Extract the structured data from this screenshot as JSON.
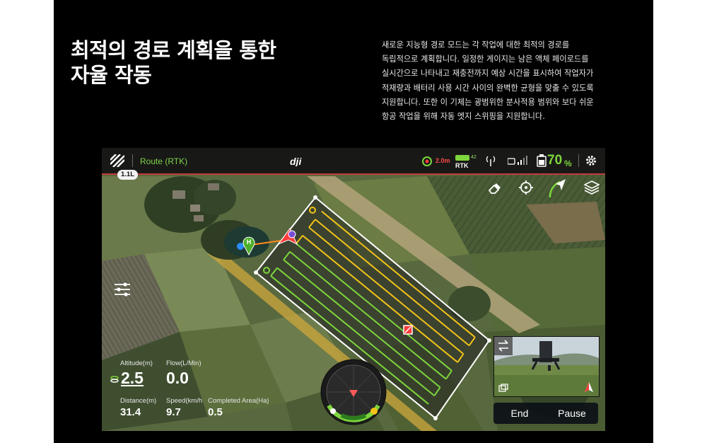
{
  "headline": {
    "line1": "최적의 경로 계획을 통한",
    "line2": "자율 작동"
  },
  "description": [
    "새로운 지능형 경로 모드는 각 작업에 대한 최적의 경로를",
    "독립적으로 계획합니다. 일정한 게이지는 남은 액체 페이로드를",
    "실시간으로 나타내고 재충전까지 예상 시간을 표시하여 작업자가",
    "적재량과 배터리 사용 시간 사이의 완벽한 균형을 맞출 수 있도록",
    "지원합니다. 또한 이 기체는 광범위한 분사적용 범위와 보다 쉬운",
    "항공 작업을 위해 자동 엣지 스위핑을 지원합니다."
  ],
  "app": {
    "mode_label": "Route (RTK)",
    "tank_badge": "1.1L",
    "obstacle_distance": "2.0m",
    "rtk_label": "RTK",
    "rtk_count": "42",
    "battery_percent": "70",
    "battery_unit": "%",
    "colors": {
      "accent": "#7fd24a",
      "alert": "#ff3b3b",
      "route_done": "#7dd63c",
      "route_pending": "#f2c318"
    },
    "icons": [
      "menu-stripes-icon",
      "dji-logo-icon",
      "obstacle-radar-icon",
      "rtk-icon",
      "signal-icon",
      "remote-signal-icon",
      "battery-icon",
      "gear-icon",
      "eraser-icon",
      "crosshair-icon",
      "navigation-arrow-icon",
      "layers-icon",
      "sliders-icon",
      "swap-icon",
      "pip-icon",
      "north-arrow-icon"
    ]
  },
  "stats": {
    "altitude": {
      "label": "Altitude(m)",
      "value": "2.5"
    },
    "flow": {
      "label": "Flow(L/Min)",
      "value": "0.0"
    },
    "distance": {
      "label": "Distance(m)",
      "value": "31.4"
    },
    "speed": {
      "label": "Speed(km/h",
      "value": "9.7"
    },
    "area": {
      "label": "Completed Area(Ha)",
      "value": "0.5"
    }
  },
  "map": {
    "home_marker": "H"
  },
  "controls": {
    "end_label": "End",
    "pause_label": "Pause"
  }
}
